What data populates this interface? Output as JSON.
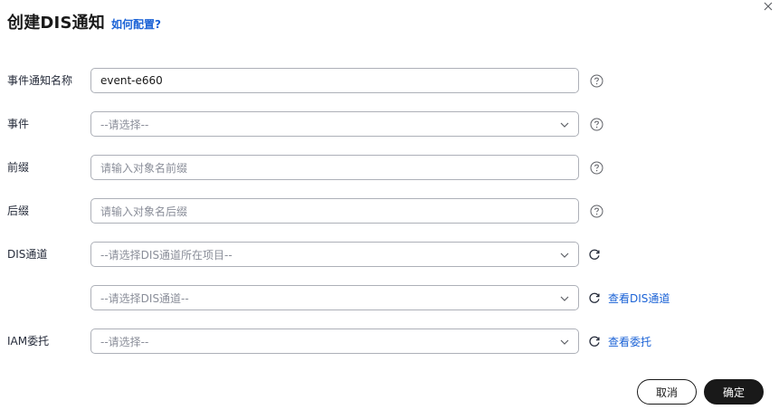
{
  "dialog": {
    "title": "创建DIS通知",
    "help_link": "如何配置?",
    "close_icon": "close-icon"
  },
  "form": {
    "event_name": {
      "label": "事件通知名称",
      "value": "event-e660"
    },
    "event": {
      "label": "事件",
      "placeholder": "--请选择--"
    },
    "prefix": {
      "label": "前缀",
      "placeholder": "请输入对象名前缀"
    },
    "suffix": {
      "label": "后缀",
      "placeholder": "请输入对象名后缀"
    },
    "dis_channel": {
      "label": "DIS通道",
      "project_placeholder": "--请选择DIS通道所在项目--",
      "channel_placeholder": "--请选择DIS通道--",
      "view_link": "查看DIS通道"
    },
    "iam_agency": {
      "label": "IAM委托",
      "placeholder": "--请选择--",
      "view_link": "查看委托"
    }
  },
  "footer": {
    "cancel_label": "取消",
    "ok_label": "确定"
  },
  "colors": {
    "link": "#1a62d6",
    "primary_button": "#191919",
    "border": "#adb0b8",
    "placeholder": "#8a8e99"
  }
}
